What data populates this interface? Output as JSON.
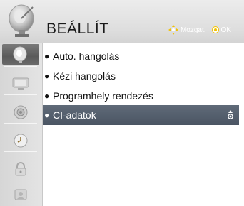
{
  "header": {
    "title": "BEÁLLÍT",
    "hint_move": "Mozgat.",
    "hint_ok": "OK",
    "logo_icon": "satellite-dish-icon"
  },
  "sidebar": {
    "items": [
      {
        "icon": "satellite-dish-icon",
        "active": true
      },
      {
        "icon": "picture-icon",
        "active": false
      },
      {
        "icon": "audio-icon",
        "active": false
      },
      {
        "icon": "clock-icon",
        "active": false
      },
      {
        "icon": "lock-icon",
        "active": false
      },
      {
        "icon": "option-icon",
        "active": false
      }
    ]
  },
  "menu": {
    "items": [
      {
        "label": "Auto. hangolás",
        "selected": false
      },
      {
        "label": "Kézi hangolás",
        "selected": false
      },
      {
        "label": "Programhely rendezés",
        "selected": false
      },
      {
        "label": "CI-adatok",
        "selected": true
      }
    ]
  },
  "colors": {
    "selection": "#56606e",
    "sidebar_active": "#6a6a6a",
    "header_bg": "#e2e2e2"
  }
}
